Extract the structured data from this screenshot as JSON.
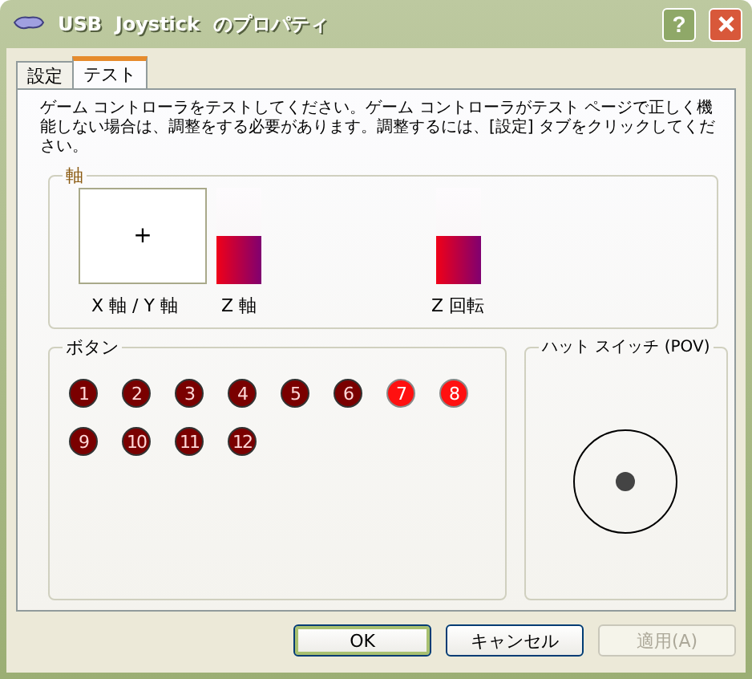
{
  "window": {
    "title": "USB  Joystick  のプロパティ",
    "help_button": "?"
  },
  "tabs": [
    {
      "label": "設定",
      "selected": false
    },
    {
      "label": "テスト",
      "selected": true
    }
  ],
  "description": "ゲーム コントローラをテストしてください。ゲーム コントローラがテスト ページで正しく機能しない場合は、調整をする必要があります。調整するには、[設定] タブをクリックしてください。",
  "axes": {
    "title": "軸",
    "xy_label": "X 軸 / Y 軸",
    "xy_marker": "+",
    "bars": [
      {
        "label": "Z 軸",
        "level": 0.5
      },
      {
        "label": "Z 回転",
        "level": 0.5
      }
    ]
  },
  "buttons_group": {
    "title": "ボタン",
    "buttons": [
      {
        "label": "1",
        "pressed": false
      },
      {
        "label": "2",
        "pressed": false
      },
      {
        "label": "3",
        "pressed": false
      },
      {
        "label": "4",
        "pressed": false
      },
      {
        "label": "5",
        "pressed": false
      },
      {
        "label": "6",
        "pressed": false
      },
      {
        "label": "7",
        "pressed": true
      },
      {
        "label": "8",
        "pressed": true
      },
      {
        "label": "9",
        "pressed": false
      },
      {
        "label": "10",
        "pressed": false
      },
      {
        "label": "11",
        "pressed": false
      },
      {
        "label": "12",
        "pressed": false
      }
    ]
  },
  "pov": {
    "title": "ハット スイッチ (POV)"
  },
  "dialog_buttons": [
    {
      "label": "OK",
      "disabled": false,
      "default": true
    },
    {
      "label": "キャンセル",
      "disabled": false,
      "default": false
    },
    {
      "label": "適用(A)",
      "disabled": true,
      "default": false
    }
  ]
}
